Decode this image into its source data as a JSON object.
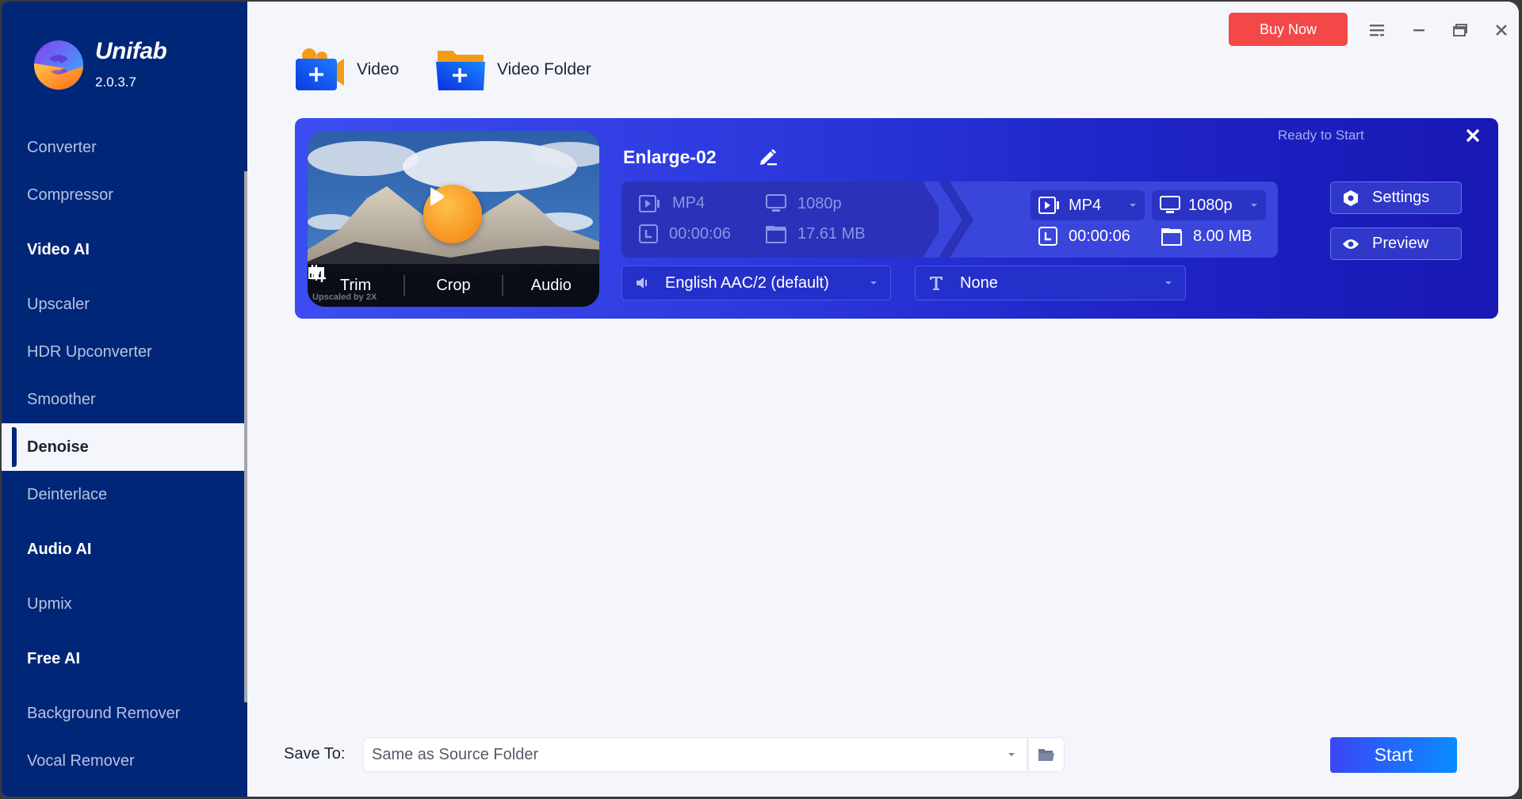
{
  "app": {
    "name": "Unifab",
    "version": "2.0.3.7"
  },
  "titlebar": {
    "buy_label": "Buy Now",
    "icons": [
      "menu-icon",
      "minimize-icon",
      "restore-icon",
      "close-icon"
    ]
  },
  "sidebar": {
    "items": [
      {
        "label": "Converter",
        "type": "item"
      },
      {
        "label": "Compressor",
        "type": "item"
      },
      {
        "label": "Video AI",
        "type": "group"
      },
      {
        "label": "Upscaler",
        "type": "item"
      },
      {
        "label": "HDR Upconverter",
        "type": "item"
      },
      {
        "label": "Smoother",
        "type": "item"
      },
      {
        "label": "Denoise",
        "type": "item",
        "active": true
      },
      {
        "label": "Deinterlace",
        "type": "item"
      },
      {
        "label": "Audio AI",
        "type": "group"
      },
      {
        "label": "Upmix",
        "type": "item"
      },
      {
        "label": "Free AI",
        "type": "group"
      },
      {
        "label": "Background Remover",
        "type": "item"
      },
      {
        "label": "Vocal Remover",
        "type": "item"
      }
    ]
  },
  "toolbar": {
    "add_video_label": "Video",
    "add_folder_label": "Video Folder"
  },
  "task": {
    "title": "Enlarge-02",
    "status": "Ready to Start",
    "thumbnail": {
      "watermark": "Upscaled by 2X",
      "actions": [
        "Trim",
        "Crop",
        "Audio"
      ]
    },
    "source": {
      "format": "MP4",
      "resolution": "1080p",
      "duration": "00:00:06",
      "size": "17.61 MB"
    },
    "output": {
      "format": "MP4",
      "resolution": "1080p",
      "duration": "00:00:06",
      "size": "8.00 MB"
    },
    "audio_track": "English AAC/2 (default)",
    "subtitle": "None",
    "settings_label": "Settings",
    "preview_label": "Preview"
  },
  "footer": {
    "save_to_label": "Save To:",
    "save_to_value": "Same as Source Folder",
    "start_label": "Start"
  },
  "colors": {
    "sidebar_bg": "#002677",
    "buy_button": "#f44848",
    "card_start": "#3c4df2",
    "card_end": "#1818b3",
    "start_start": "#3a46f5",
    "start_end": "#0a8cff"
  }
}
